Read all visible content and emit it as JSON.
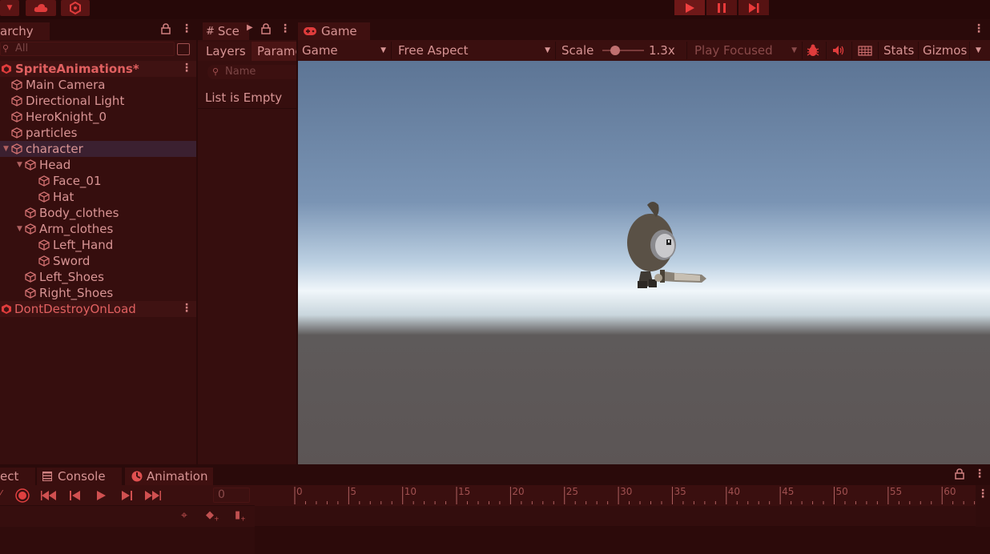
{
  "hierarchy": {
    "tab_label": "archy",
    "search_placeholder": "All",
    "scene_name": "SpriteAnimations*",
    "items": [
      {
        "label": "Main Camera",
        "depth": 1
      },
      {
        "label": "Directional Light",
        "depth": 1
      },
      {
        "label": "HeroKnight_0",
        "depth": 1
      },
      {
        "label": "particles",
        "depth": 1
      },
      {
        "label": "character",
        "depth": 1,
        "expanded": true,
        "selected": true
      },
      {
        "label": "Head",
        "depth": 2,
        "expanded": true
      },
      {
        "label": "Face_01",
        "depth": 3
      },
      {
        "label": "Hat",
        "depth": 3
      },
      {
        "label": "Body_clothes",
        "depth": 2
      },
      {
        "label": "Arm_clothes",
        "depth": 2,
        "expanded": true
      },
      {
        "label": "Left_Hand",
        "depth": 3
      },
      {
        "label": "Sword",
        "depth": 3
      },
      {
        "label": "Left_Shoes",
        "depth": 2
      },
      {
        "label": "Right_Shoes",
        "depth": 2
      }
    ],
    "dont_destroy": "DontDestroyOnLoad"
  },
  "animator": {
    "tab_label": "Sce",
    "layers_label": "Layers",
    "params_label": "Parame",
    "search_placeholder": "Name",
    "empty_text": "List is Empty"
  },
  "game": {
    "tab_label": "Game",
    "display_select": "Game",
    "aspect_select": "Free Aspect",
    "scale_label": "Scale",
    "scale_value": "1.3x",
    "scale_level": 0.3,
    "play_mode_select": "Play Focused",
    "stats_label": "Stats",
    "gizmos_label": "Gizmos"
  },
  "bottom": {
    "tabs": [
      {
        "label": "ect"
      },
      {
        "label": "Console"
      },
      {
        "label": "Animation"
      }
    ],
    "frame_value": "0",
    "timeline_ticks": [
      "0",
      "5",
      "10",
      "15",
      "20",
      "25",
      "30",
      "35",
      "40",
      "45",
      "50",
      "55",
      "60"
    ]
  },
  "colors": {
    "tint": "#e03c3c",
    "panel": "#360e0e",
    "sky_top": "#5c7898",
    "sky_horizon": "#eef4f8",
    "ground": "#5f5858"
  },
  "icons": [
    "cloud-icon",
    "collab-icon",
    "play-icon",
    "pause-icon",
    "step-icon",
    "lock-icon",
    "kebab-icon",
    "gamepad-icon",
    "bug-icon",
    "audio-icon",
    "grid-icon",
    "record-icon"
  ]
}
